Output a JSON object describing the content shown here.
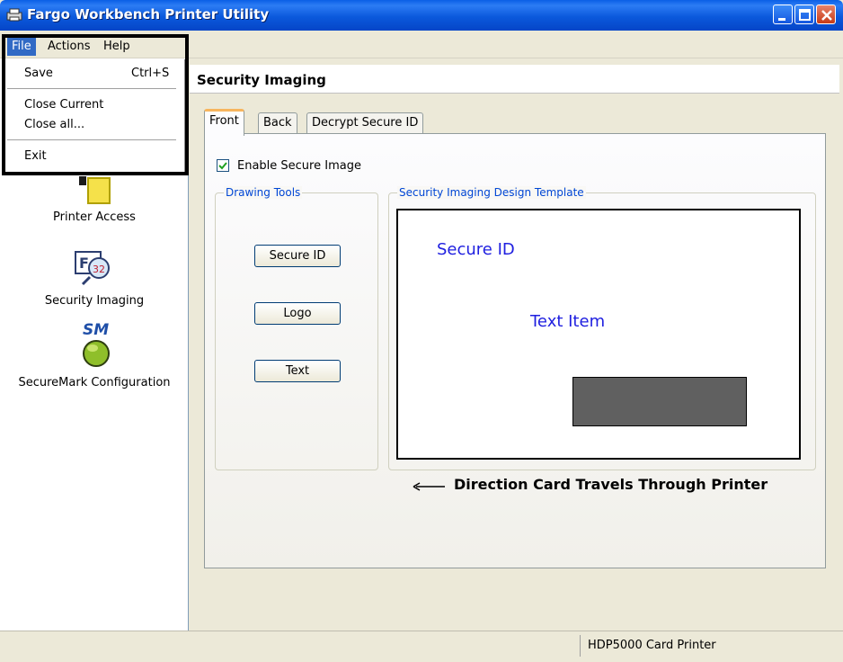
{
  "window": {
    "title": "Fargo Workbench Printer Utility",
    "icon": "printer-app-icon"
  },
  "menubar": {
    "items": [
      "File",
      "Actions",
      "Help"
    ],
    "active": "File"
  },
  "file_menu": {
    "items": [
      {
        "label": "Save",
        "shortcut": "Ctrl+S"
      },
      {
        "label": "Close Current"
      },
      {
        "label": "Close all..."
      },
      {
        "label": "Exit"
      }
    ]
  },
  "sidebar": {
    "items": [
      {
        "label": "Printer Access",
        "icon": "lock-icon"
      },
      {
        "label": "Security Imaging",
        "icon": "security-imaging-icon"
      },
      {
        "label": "SecureMark Configuration",
        "icon": "securemark-icon",
        "icon_text": "SM"
      }
    ]
  },
  "content": {
    "title": "Security Imaging",
    "tabs": [
      "Front",
      "Back",
      "Decrypt Secure ID"
    ],
    "active_tab": "Front",
    "enable_secure_image": {
      "label": "Enable Secure Image",
      "checked": true
    },
    "drawing_tools": {
      "legend": "Drawing Tools",
      "buttons": [
        "Secure ID",
        "Logo",
        "Text"
      ]
    },
    "template": {
      "legend": "Security Imaging Design Template",
      "items": [
        "Secure ID",
        "Text Item"
      ]
    },
    "direction_text": "Direction Card Travels Through Printer"
  },
  "statusbar": {
    "printer": "HDP5000 Card Printer"
  },
  "colors": {
    "titlebar": "#0b59dc",
    "menu_highlight": "#316ac5",
    "legend_text": "#0046d5",
    "template_text": "#2020e0",
    "template_rect": "#606060"
  }
}
